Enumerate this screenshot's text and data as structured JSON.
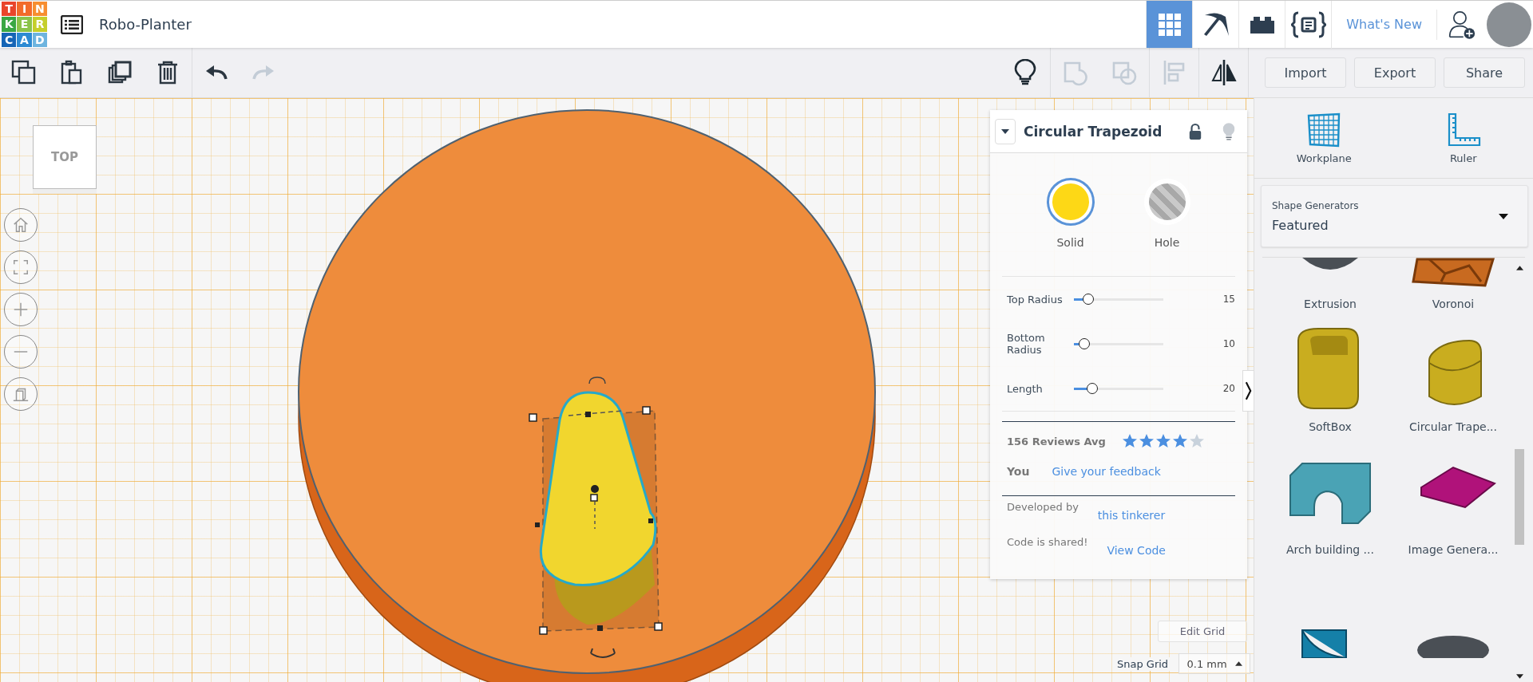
{
  "app": {
    "logo_letters": [
      "T",
      "I",
      "N",
      "K",
      "E",
      "R",
      "C",
      "A",
      "D"
    ],
    "title": "Robo-Planter"
  },
  "view_modes": [
    {
      "kind": "grid",
      "selected": true
    },
    {
      "kind": "pickaxe",
      "selected": false
    },
    {
      "kind": "bricks",
      "selected": false
    },
    {
      "kind": "codeblocks",
      "selected": false
    }
  ],
  "whats_new": "What's New",
  "edit_tools": [
    {
      "kind": "copy",
      "disabled": false
    },
    {
      "kind": "paste",
      "disabled": false
    },
    {
      "kind": "duplicate",
      "disabled": false
    },
    {
      "kind": "delete",
      "disabled": false
    },
    {
      "kind": "undo",
      "disabled": false
    },
    {
      "kind": "redo",
      "disabled": true
    }
  ],
  "shape_tools": [
    {
      "kind": "notes",
      "disabled": false
    },
    {
      "kind": "group",
      "disabled": true
    },
    {
      "kind": "ungroup",
      "disabled": true
    },
    {
      "kind": "align",
      "disabled": true
    },
    {
      "kind": "mirror",
      "disabled": false
    }
  ],
  "actions": [
    "Import",
    "Export",
    "Share"
  ],
  "view_cube": {
    "face": "TOP"
  },
  "view_controls": [
    {
      "kind": "home"
    },
    {
      "kind": "fit"
    },
    {
      "kind": "zoom-in"
    },
    {
      "kind": "zoom-out"
    },
    {
      "kind": "perspective"
    }
  ],
  "inspector": {
    "title": "Circular Trapezoid",
    "locked": false,
    "materials": [
      {
        "kind": "solid",
        "label": "Solid",
        "selected": true
      },
      {
        "kind": "hole",
        "label": "Hole",
        "selected": false
      }
    ],
    "params": [
      {
        "label": "Top Radius",
        "level": 0.12,
        "value": "15"
      },
      {
        "label": "Bottom Radius",
        "level": 0.07,
        "value": "10"
      },
      {
        "label": "Length",
        "level": 0.16,
        "value": "20"
      }
    ],
    "reviews": {
      "label": "156 Reviews Avg",
      "stars": 4
    },
    "you": {
      "label": "You",
      "link": "Give your feedback"
    },
    "developed": {
      "label": "Developed by",
      "link": "this tinkerer"
    },
    "code": {
      "label": "Code is shared!",
      "link": "View Code"
    }
  },
  "grid": {
    "edit": "Edit Grid",
    "snap_label": "Snap Grid",
    "snap_value": "0.1 mm"
  },
  "sidebar": {
    "tools": [
      {
        "kind": "workplane",
        "label": "Workplane"
      },
      {
        "kind": "ruler",
        "label": "Ruler"
      }
    ],
    "category": {
      "label": "Shape Generators",
      "value": "Featured"
    },
    "shapes": [
      {
        "kind": "extrusion",
        "label": "Extrusion"
      },
      {
        "kind": "voronoi",
        "label": "Voronoi"
      },
      {
        "kind": "softbox",
        "label": "SoftBox"
      },
      {
        "kind": "trapezoid",
        "label": "Circular Trape..."
      },
      {
        "kind": "arch",
        "label": "Arch building ..."
      },
      {
        "kind": "image",
        "label": "Image Genera..."
      },
      {
        "kind": "wedge"
      },
      {
        "kind": "cylinder"
      }
    ]
  }
}
